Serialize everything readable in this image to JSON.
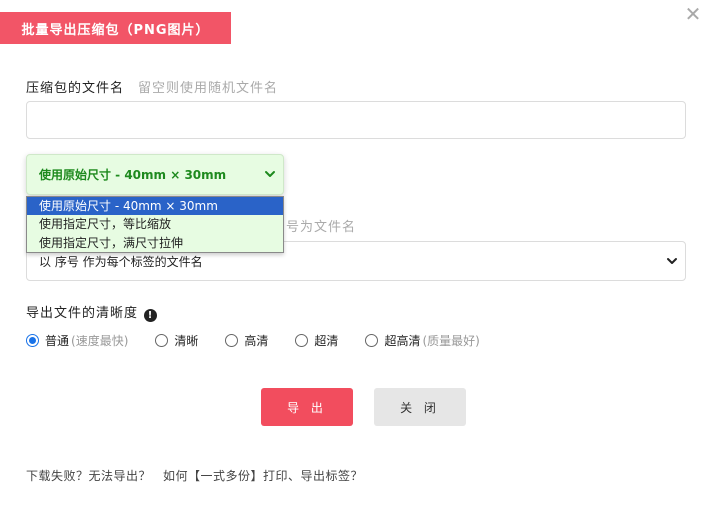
{
  "dialog": {
    "title": "批量导出压缩包（PNG图片）",
    "close_icon": "close-icon"
  },
  "zip_name": {
    "label": "压缩包的文件名",
    "hint": "留空则使用随机文件名",
    "value": "",
    "placeholder": ""
  },
  "size_select": {
    "selected": "使用原始尺寸 - 40mm × 30mm",
    "options": [
      "使用原始尺寸 - 40mm × 30mm",
      "使用指定尺寸，等比缩放",
      "使用指定尺寸，满尺寸拉伸"
    ]
  },
  "naming": {
    "label_partial": "号为文件名",
    "selected": "以 序号 作为每个标签的文件名"
  },
  "quality": {
    "label": "导出文件的清晰度",
    "info_icon": "info-icon",
    "options": [
      {
        "label": "普通",
        "note": "(速度最快)",
        "checked": true
      },
      {
        "label": "清晰",
        "note": "",
        "checked": false
      },
      {
        "label": "高清",
        "note": "",
        "checked": false
      },
      {
        "label": "超清",
        "note": "",
        "checked": false
      },
      {
        "label": "超高清",
        "note": "(质量最好)",
        "checked": false
      }
    ]
  },
  "buttons": {
    "export": "导 出",
    "close": "关 闭"
  },
  "footer": {
    "link1": "下载失败？无法导出？",
    "link2": "如何【一式多份】打印、导出标签？"
  },
  "colors": {
    "accent": "#f24d5e",
    "select_bg": "#e7fce2",
    "select_text": "#1e8a1e",
    "highlight": "#2a63c8"
  }
}
